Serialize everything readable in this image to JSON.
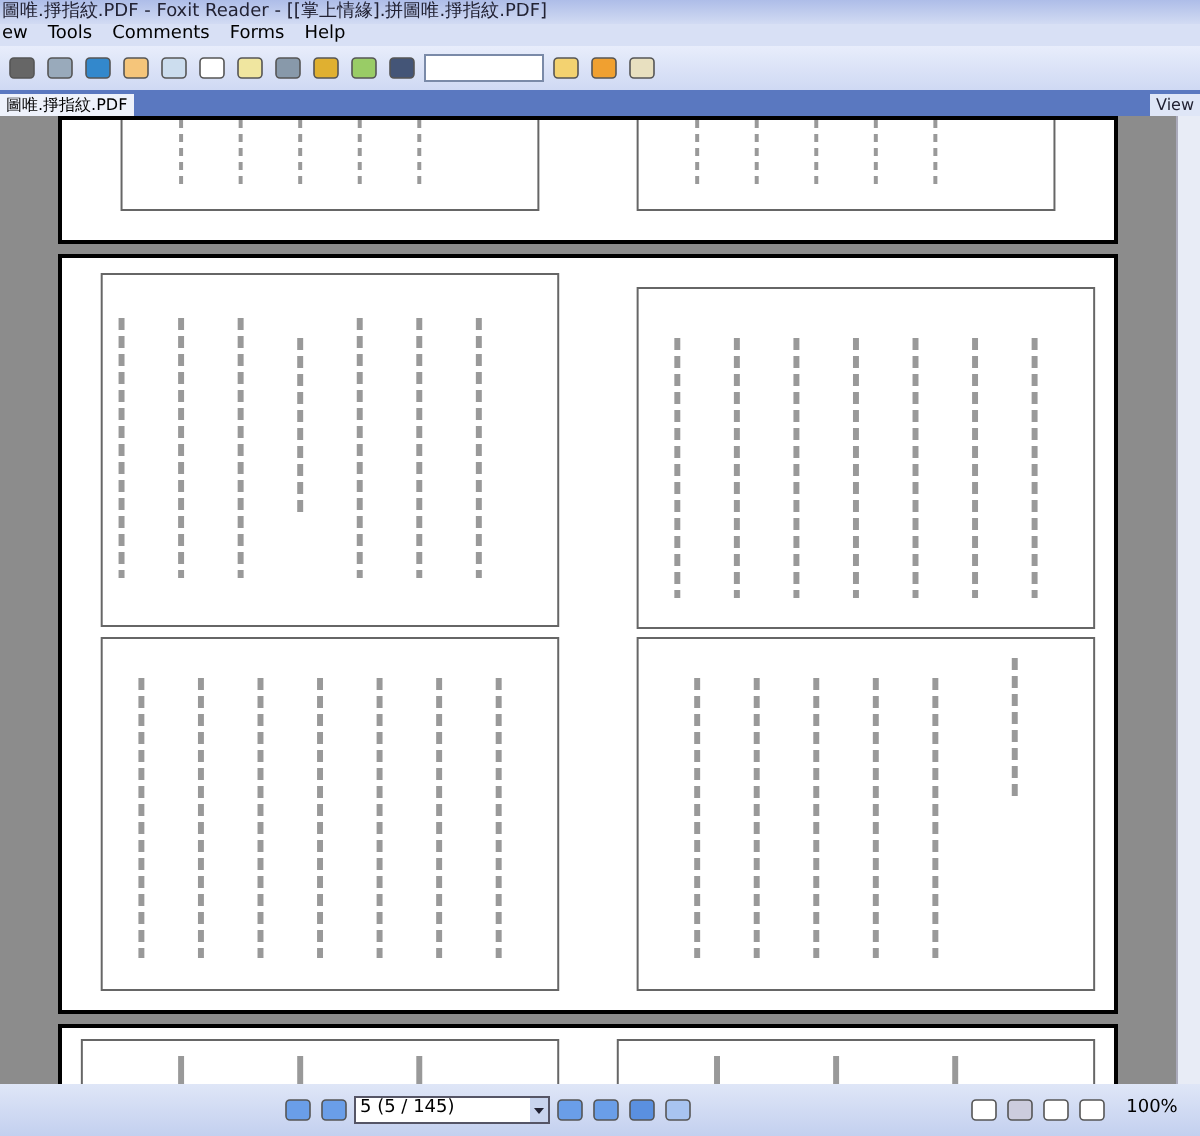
{
  "window": {
    "title": "圖唯.掙指紋.PDF - Foxit Reader - [[掌上情緣].拼圖唯.掙指紋.PDF]"
  },
  "menu": [
    "ew",
    "Tools",
    "Comments",
    "Forms",
    "Help"
  ],
  "tabs": [
    {
      "label": "圖唯.掙指紋.PDF",
      "selected": true
    },
    {
      "label": "View",
      "selected": false
    }
  ],
  "status_bar": {
    "page": "5 (5 / 145)",
    "zoom": "100%"
  }
}
